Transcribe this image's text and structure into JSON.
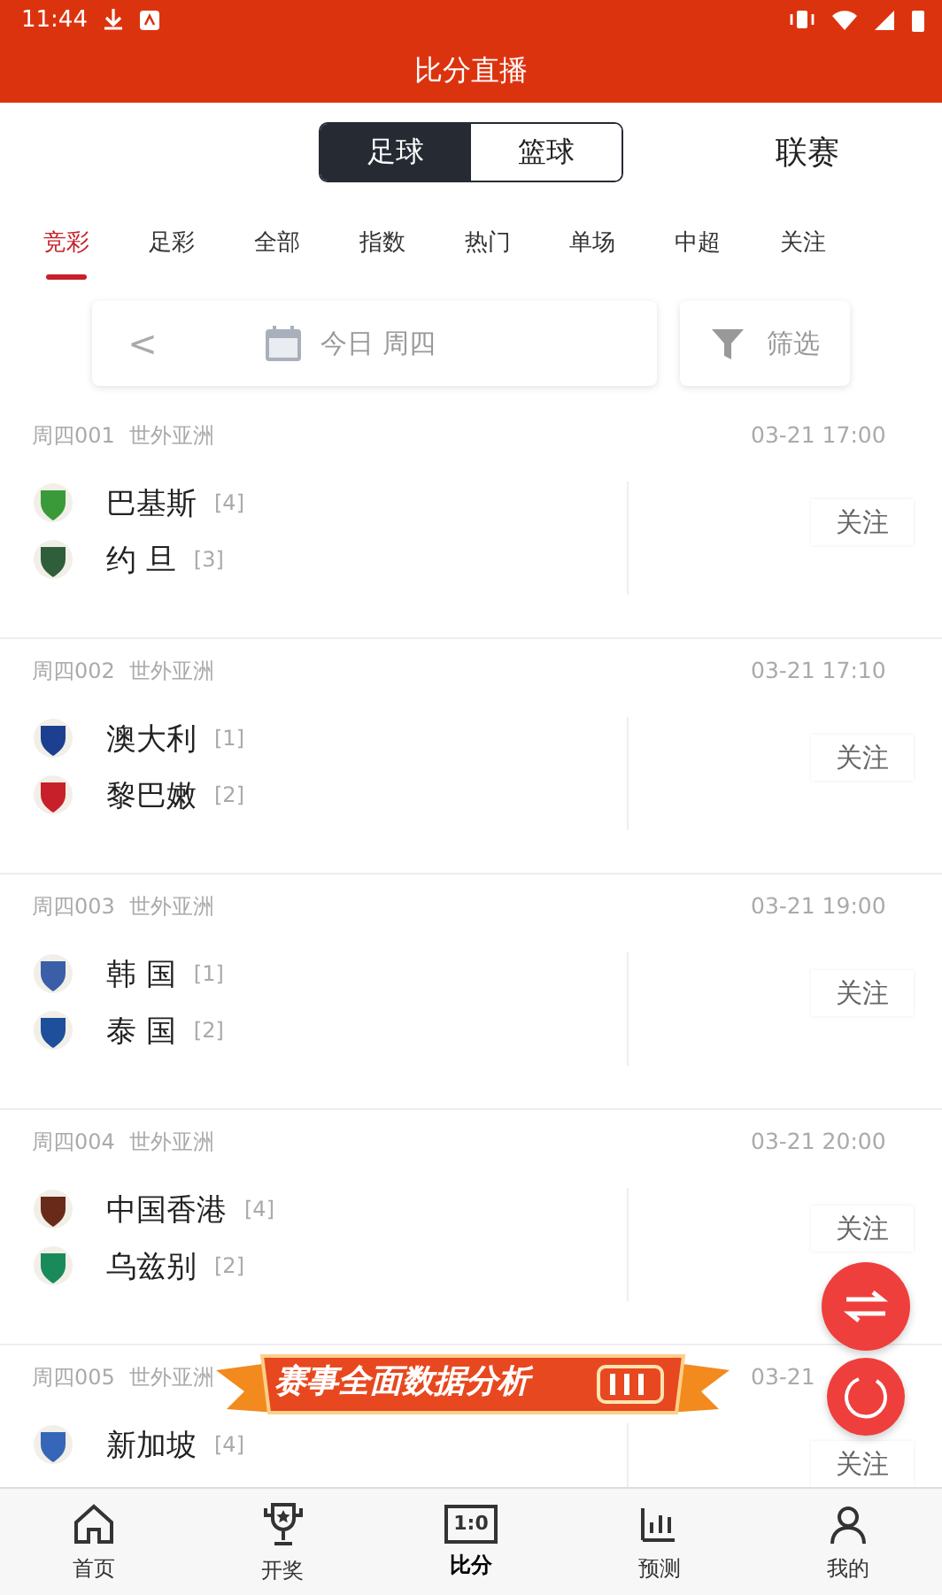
{
  "status_bar": {
    "time": "11:44"
  },
  "title": "比分直播",
  "sport_switch": [
    {
      "label": "足球",
      "selected": true
    },
    {
      "label": "篮球",
      "selected": false
    }
  ],
  "league_button": "联赛",
  "tabs": [
    {
      "label": "竞彩",
      "selected": true
    },
    {
      "label": "足彩",
      "selected": false
    },
    {
      "label": "全部",
      "selected": false
    },
    {
      "label": "指数",
      "selected": false
    },
    {
      "label": "热门",
      "selected": false
    },
    {
      "label": "单场",
      "selected": false
    },
    {
      "label": "中超",
      "selected": false
    },
    {
      "label": "关注",
      "selected": false
    }
  ],
  "date_bar": {
    "back": "<",
    "date": "今日 周四",
    "filter": "筛选"
  },
  "matches": [
    {
      "code": "周四001",
      "league": "世外亚洲",
      "time": "03-21 17:00",
      "follow": "关注",
      "teams": [
        {
          "name": "巴基斯",
          "rank": "[4]"
        },
        {
          "name": "约 旦",
          "rank": "[3]"
        }
      ]
    },
    {
      "code": "周四002",
      "league": "世外亚洲",
      "time": "03-21 17:10",
      "follow": "关注",
      "teams": [
        {
          "name": "澳大利",
          "rank": "[1]"
        },
        {
          "name": "黎巴嫩",
          "rank": "[2]"
        }
      ]
    },
    {
      "code": "周四003",
      "league": "世外亚洲",
      "time": "03-21 19:00",
      "follow": "关注",
      "teams": [
        {
          "name": "韩 国",
          "rank": "[1]"
        },
        {
          "name": "泰 国",
          "rank": "[2]"
        }
      ]
    },
    {
      "code": "周四004",
      "league": "世外亚洲",
      "time": "03-21 20:00",
      "follow": "关注",
      "teams": [
        {
          "name": "中国香港",
          "rank": "[4]"
        },
        {
          "name": "乌兹别",
          "rank": "[2]"
        }
      ]
    },
    {
      "code": "周四005",
      "league": "世外亚洲",
      "time": "03-21",
      "follow": "关注",
      "teams": [
        {
          "name": "新加坡",
          "rank": "[4]"
        }
      ]
    }
  ],
  "banner": {
    "text": "赛事全面数据分析"
  },
  "nav": [
    {
      "label": "首页",
      "kind": "home",
      "selected": false
    },
    {
      "label": "开奖",
      "kind": "trophy",
      "selected": false
    },
    {
      "label": "比分",
      "kind": "score",
      "icon_text": "1:0",
      "selected": true
    },
    {
      "label": "预测",
      "kind": "chart",
      "selected": false
    },
    {
      "label": "我的",
      "kind": "user",
      "selected": false
    }
  ]
}
